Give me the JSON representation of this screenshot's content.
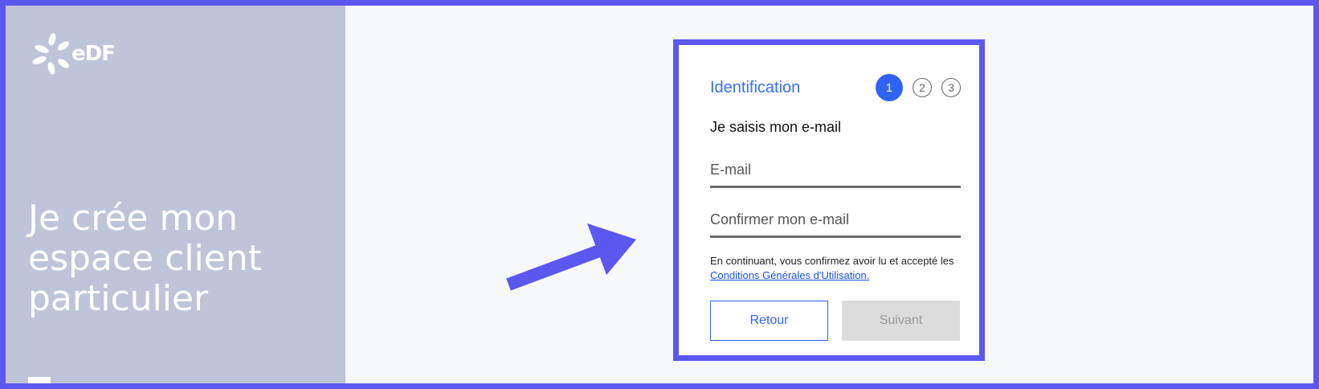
{
  "brand": {
    "logo_text": "eDF",
    "accent": "#2f64f2",
    "highlight": "#5b57ef"
  },
  "hero": {
    "title": "Je crée mon espace client particulier"
  },
  "card": {
    "title": "Identification",
    "steps": [
      "1",
      "2",
      "3"
    ],
    "active_step": 1,
    "subtitle": "Je saisis mon e-mail",
    "email_placeholder": "E-mail",
    "confirm_placeholder": "Confirmer mon e-mail",
    "legal_text": "En continuant, vous confirmez avoir lu et accepté les",
    "legal_link": "Conditions Générales d'Utilisation.",
    "back_label": "Retour",
    "next_label": "Suivant"
  },
  "annotations": {
    "arrow_icon": "arrow-pointer-icon"
  }
}
